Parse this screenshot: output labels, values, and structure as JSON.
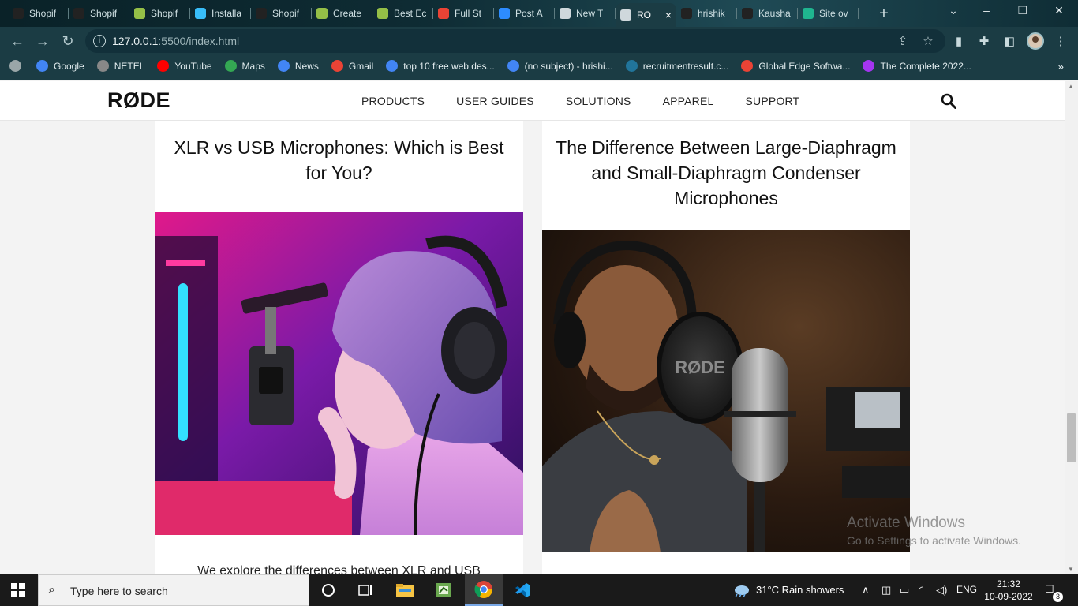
{
  "browser": {
    "tabs": [
      {
        "label": "Shopif",
        "icon": "github-icon",
        "color": "#222"
      },
      {
        "label": "Shopif",
        "icon": "github-icon",
        "color": "#222"
      },
      {
        "label": "Shopif",
        "icon": "shopify-icon",
        "color": "#95bf47"
      },
      {
        "label": "Installa",
        "icon": "tailwind-icon",
        "color": "#38bdf8"
      },
      {
        "label": "Shopif",
        "icon": "github-icon",
        "color": "#222"
      },
      {
        "label": "Create",
        "icon": "shopify-icon",
        "color": "#95bf47"
      },
      {
        "label": "Best Ec",
        "icon": "shopify-icon",
        "color": "#95bf47"
      },
      {
        "label": "Full St",
        "icon": "gmail-icon",
        "color": "#ea4335"
      },
      {
        "label": "Post A",
        "icon": "zoom-icon",
        "color": "#2d8cff"
      },
      {
        "label": "New T",
        "icon": "chrome-icon",
        "color": "#cfd8dc"
      },
      {
        "label": "RO",
        "icon": "globe-icon",
        "color": "#cfd8dc",
        "active": true
      },
      {
        "label": "hrishik",
        "icon": "github-icon",
        "color": "#222"
      },
      {
        "label": "Kausha",
        "icon": "github-icon",
        "color": "#222"
      },
      {
        "label": "Site ov",
        "icon": "diamond-icon",
        "color": "#1fb58f"
      }
    ],
    "tab_close": "×",
    "new_tab": "+",
    "url_host": "127.0.0.1",
    "url_rest": ":5500/index.html",
    "bookmarks": [
      {
        "label": "Google",
        "color": "#4285f4"
      },
      {
        "label": "NETEL",
        "color": "#888888"
      },
      {
        "label": "YouTube",
        "color": "#ff0000"
      },
      {
        "label": "Maps",
        "color": "#34a853"
      },
      {
        "label": "News",
        "color": "#4285f4"
      },
      {
        "label": "Gmail",
        "color": "#ea4335"
      },
      {
        "label": "top 10 free web des...",
        "color": "#4285f4"
      },
      {
        "label": "(no subject) - hrishi...",
        "color": "#4285f4"
      },
      {
        "label": "recruitmentresult.c...",
        "color": "#21759b"
      },
      {
        "label": "Global Edge Softwa...",
        "color": "#ea4335"
      },
      {
        "label": "The Complete 2022...",
        "color": "#a435f0"
      }
    ],
    "bookmarks_more": "»"
  },
  "site": {
    "logo": "RØDE",
    "nav": [
      "PRODUCTS",
      "USER GUIDES",
      "SOLUTIONS",
      "APPAREL",
      "SUPPORT"
    ],
    "cards": [
      {
        "title": "XLR vs USB Microphones: Which is Best for You?",
        "text": "We explore the differences between XLR and USB"
      },
      {
        "title": "The Difference Between Large-Diaphragm and Small-Diaphragm Condenser Microphones",
        "text": ""
      }
    ],
    "mic_brand_1": "RØDE",
    "mic_brand_2": "RØDE"
  },
  "watermark": {
    "title": "Activate Windows",
    "subtitle": "Go to Settings to activate Windows."
  },
  "taskbar": {
    "search_placeholder": "Type here to search",
    "weather": "31°C  Rain showers",
    "language": "ENG",
    "time": "21:32",
    "date": "10-09-2022",
    "notifications": "3"
  }
}
